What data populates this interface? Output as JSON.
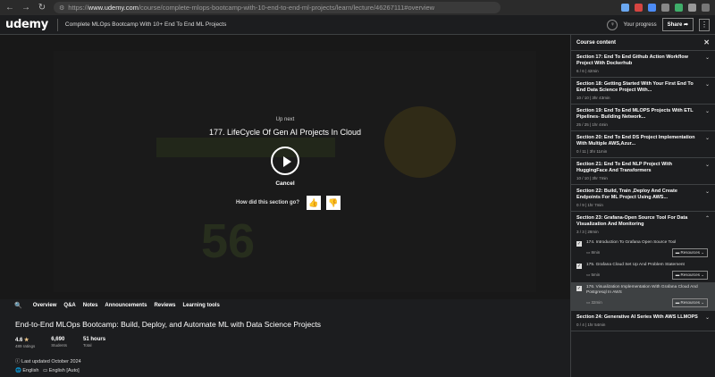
{
  "browser": {
    "url_prefix": "https://",
    "url_host": "www.udemy.com",
    "url_path": "/course/complete-mlops-bootcamp-with-10-end-to-end-ml-projects/learn/lecture/46267111#overview"
  },
  "app": {
    "logo": "udemy",
    "course_title": "Complete MLOps Bootcamp With 10+ End To End ML Projects",
    "progress_label": "Your progress",
    "share_label": "Share",
    "more_label": "⋮"
  },
  "player": {
    "up_next": "Up next",
    "next_title": "177. LifeCycle Of Gen AI Projects In Cloud",
    "cancel": "Cancel",
    "rate_question": "How did this section go?"
  },
  "tabs": [
    "Overview",
    "Q&A",
    "Notes",
    "Announcements",
    "Reviews",
    "Learning tools"
  ],
  "course": {
    "title": "End-to-End MLOps Bootcamp: Build, Deploy, and Automate ML with Data Science Projects",
    "rating": "4.6",
    "ratings_label": "489 ratings",
    "students": "6,690",
    "students_label": "Students",
    "hours": "51 hours",
    "hours_label": "Total",
    "last_updated": "Last updated October 2024",
    "language": "English",
    "captions": "English [Auto]"
  },
  "sidebar": {
    "title": "Course content",
    "sections": [
      {
        "title": "Section 17: End To End Github Action Workflow Project With Dockerhub",
        "meta": "6 / 6 | 42min"
      },
      {
        "title": "Section 18: Getting Started With Your First End To End Data Science Project With...",
        "meta": "10 / 10 | 3hr 43min"
      },
      {
        "title": "Section 19: End To End MLOPS Projects With ETL Pipelines- Building Network...",
        "meta": "25 / 25 | 1hr 4min"
      },
      {
        "title": "Section 20: End To End DS Project Implementation With Multiple AWS,Azur...",
        "meta": "0 / 11 | 3hr 11min"
      },
      {
        "title": "Section 21: End To End NLP Project With HuggingFace And Transformers",
        "meta": "10 / 10 | 3hr 7min"
      },
      {
        "title": "Section 22: Build, Train ,Deploy And Create Endpoints For ML Project Using AWS...",
        "meta": "0 / 9 | 1hr 7min"
      },
      {
        "title": "Section 23: Grafana-Open Source Tool For Data Visualization And Monitoring",
        "meta": "3 / 3 | 28min"
      }
    ],
    "lessons": [
      {
        "title": "174. Introduction To Grafana Open Source Tool",
        "duration": "8min",
        "resources": "Resources"
      },
      {
        "title": "175. Grafana Cloud Set Up And Problem Statement",
        "duration": "5min",
        "resources": "Resources"
      },
      {
        "title": "176. Visualization Implementation With Grafana Cloud And Postgresql In AWS",
        "duration": "32min",
        "resources": "Resources"
      }
    ],
    "last_section": {
      "title": "Section 24: Generative AI Series With AWS LLMOPS",
      "meta": "0 / 4 | 1hr 54min"
    }
  }
}
